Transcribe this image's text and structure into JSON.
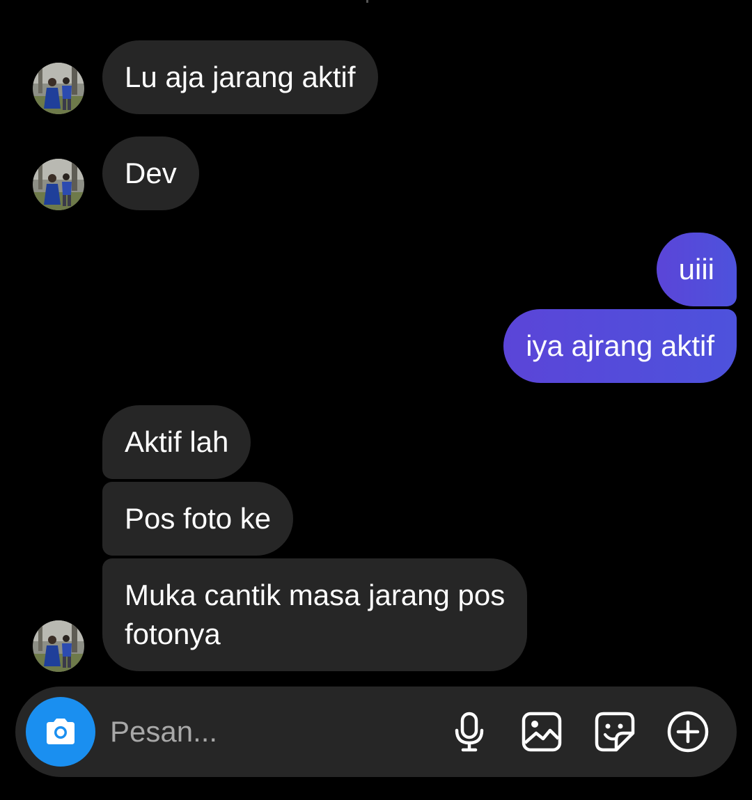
{
  "conversation": {
    "messages": [
      {
        "direction": "incoming",
        "text": "Lu aja jarang aktif"
      },
      {
        "direction": "incoming",
        "text": "Dev"
      },
      {
        "direction": "outgoing",
        "text": "uiii"
      },
      {
        "direction": "outgoing",
        "text": "iya ajrang aktif"
      },
      {
        "direction": "incoming",
        "text": "Aktif lah"
      },
      {
        "direction": "incoming",
        "text": "Pos foto ke"
      },
      {
        "direction": "incoming",
        "text": "Muka cantik masa jarang pos"
      },
      {
        "direction": "incoming",
        "text": "fotonya"
      }
    ]
  },
  "composer": {
    "placeholder": "Pesan...",
    "value": "",
    "camera_icon": "camera-icon",
    "tools": [
      "microphone-icon",
      "gallery-icon",
      "sticker-icon",
      "add-icon"
    ]
  },
  "colors": {
    "background": "#000000",
    "incoming_bubble": "#262626",
    "outgoing_bubble": "#5b45d8",
    "camera_button": "#1a8ff0",
    "placeholder": "#a8a8a8"
  }
}
